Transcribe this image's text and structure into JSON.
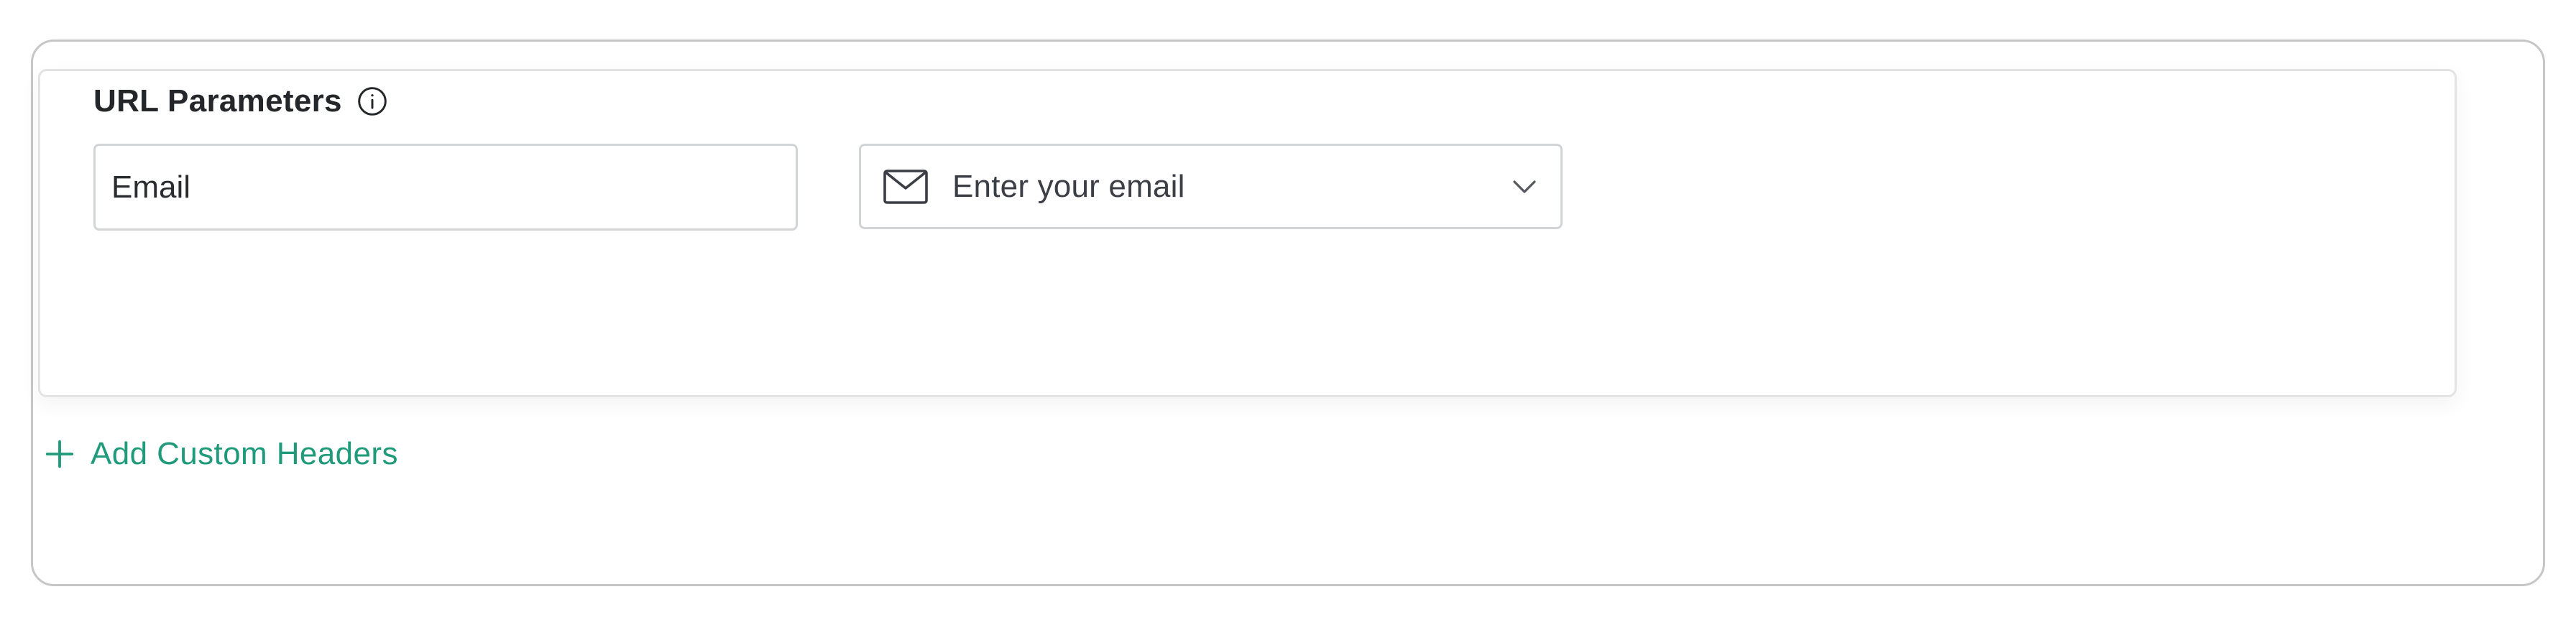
{
  "url_parameters": {
    "label": "URL Parameters",
    "info_icon": "info-circle-icon",
    "key_field": {
      "value": "Email",
      "placeholder": ""
    },
    "value_select": {
      "icon": "mail-icon",
      "placeholder": "Enter your email",
      "chevron_icon": "chevron-down-icon"
    }
  },
  "actions": {
    "add_custom_headers_label": "Add Custom Headers",
    "add_icon": "plus-icon"
  },
  "colors": {
    "accent": "#1f9a7a",
    "border": "#c6c6c6",
    "field_border": "#d2d4d6",
    "text": "#24262a"
  }
}
